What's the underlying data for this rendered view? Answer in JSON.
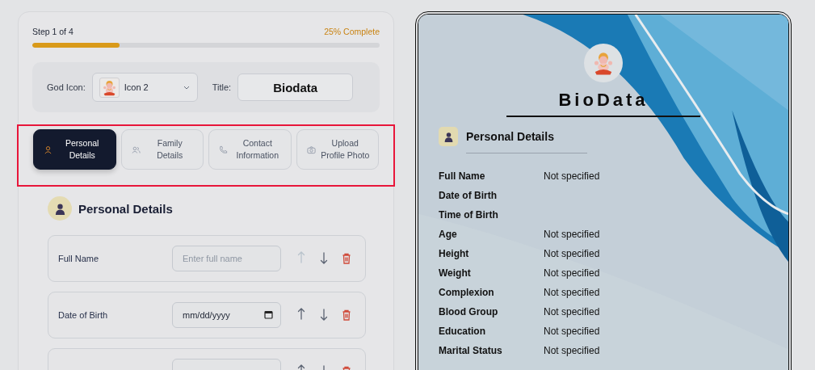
{
  "progress": {
    "step": "Step 1 of 4",
    "percent": "25% Complete",
    "level": 0.25
  },
  "settings": {
    "god_icon_label": "God Icon:",
    "god_icon_value": "Icon 2",
    "title_label": "Title:",
    "title_value": "Biodata"
  },
  "tabs_highlighted": true,
  "tabs": [
    {
      "label": "Personal Details",
      "kind": "person",
      "selected": true
    },
    {
      "label": "Family Details",
      "kind": "people",
      "selected": false
    },
    {
      "label": "Contact Information",
      "kind": "phone",
      "selected": false
    },
    {
      "label": "Upload Profile Photo",
      "kind": "camera",
      "selected": false
    }
  ],
  "section": {
    "title": "Personal Details"
  },
  "fields": [
    {
      "label": "Full Name",
      "kind": "text",
      "placeholder": "Enter full name",
      "up_disabled": true
    },
    {
      "label": "Date of Birth",
      "kind": "date",
      "placeholder": "mm/dd/yyyy",
      "up_disabled": false
    },
    {
      "kind": "text",
      "up_disabled": false
    }
  ],
  "preview": {
    "title": "BioData",
    "section_title": "Personal Details",
    "rows": [
      {
        "label": "Full Name",
        "value": "Not specified"
      },
      {
        "label": "Date of Birth"
      },
      {
        "label": "Time of Birth"
      },
      {
        "label": "Age",
        "value": "Not specified"
      },
      {
        "label": "Height",
        "value": "Not specified"
      },
      {
        "label": "Weight",
        "value": "Not specified"
      },
      {
        "label": "Complexion",
        "value": "Not specified"
      },
      {
        "label": "Blood Group",
        "value": "Not specified"
      },
      {
        "label": "Education",
        "value": "Not specified"
      },
      {
        "label": "Marital Status",
        "value": "Not specified"
      }
    ]
  }
}
